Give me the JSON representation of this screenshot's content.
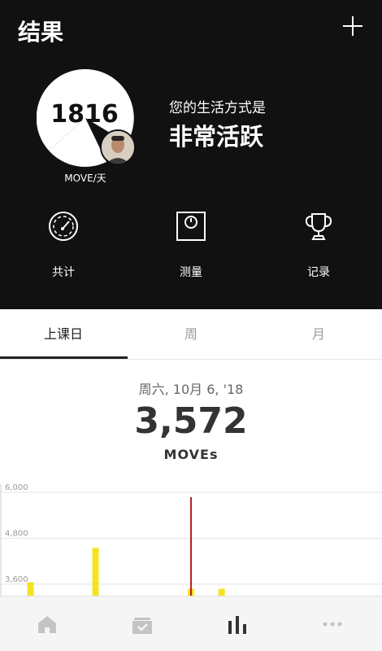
{
  "header": {
    "title": "结果"
  },
  "score": {
    "value": "1816",
    "unit": "MOVE/天"
  },
  "lifestyle": {
    "label": "您的生活方式是",
    "value": "非常活跃"
  },
  "actions": [
    {
      "label": "共计",
      "icon": "gauge-icon"
    },
    {
      "label": "测量",
      "icon": "scale-icon"
    },
    {
      "label": "记录",
      "icon": "trophy-icon"
    }
  ],
  "tabs": [
    {
      "label": "上课日",
      "active": true
    },
    {
      "label": "周",
      "active": false
    },
    {
      "label": "月",
      "active": false
    }
  ],
  "summary": {
    "date": "周六, 10月 6, '18",
    "value": "3,572",
    "unit": "MOVEs"
  },
  "chart_data": {
    "type": "bar",
    "y_ticks": [
      "6,000",
      "4,800",
      "3,600"
    ],
    "ylim": [
      3300,
      6000
    ],
    "bars": [
      {
        "x": 0.08,
        "value": 3650
      },
      {
        "x": 0.25,
        "value": 4550
      },
      {
        "x": 0.5,
        "value": 3480
      },
      {
        "x": 0.58,
        "value": 3480
      }
    ],
    "marker": {
      "x": 0.5
    },
    "colors": {
      "bar": "#f2e422",
      "marker": "#b22222"
    }
  },
  "nav": [
    {
      "icon": "home-icon"
    },
    {
      "icon": "inbox-icon"
    },
    {
      "icon": "bar-chart-icon",
      "active": true
    },
    {
      "icon": "more-icon"
    }
  ]
}
